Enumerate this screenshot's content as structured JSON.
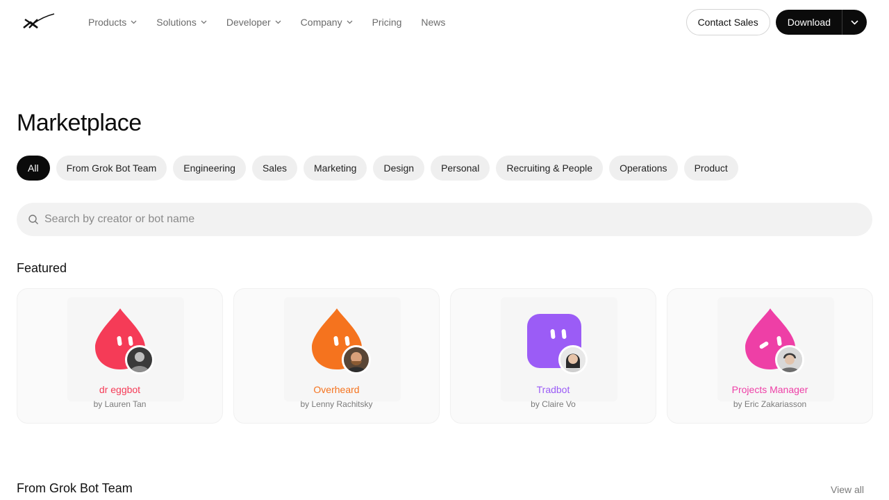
{
  "nav": {
    "items": [
      {
        "label": "Products",
        "has_dropdown": true
      },
      {
        "label": "Solutions",
        "has_dropdown": true
      },
      {
        "label": "Developer",
        "has_dropdown": true
      },
      {
        "label": "Company",
        "has_dropdown": true
      },
      {
        "label": "Pricing",
        "has_dropdown": false
      },
      {
        "label": "News",
        "has_dropdown": false
      }
    ],
    "contact_label": "Contact Sales",
    "download_label": "Download"
  },
  "page": {
    "title": "Marketplace"
  },
  "filters": {
    "chips": [
      "All",
      "From Grok Bot Team",
      "Engineering",
      "Sales",
      "Marketing",
      "Design",
      "Personal",
      "Recruiting & People",
      "Operations",
      "Product"
    ],
    "active": "All"
  },
  "search": {
    "placeholder": "Search by creator or bot name",
    "value": ""
  },
  "featured": {
    "heading": "Featured",
    "cards": [
      {
        "name": "dr eggbot",
        "author": "by Lauren Tan",
        "color": "#f53b57",
        "shape": "drop-bot-icon"
      },
      {
        "name": "Overheard",
        "author": "by Lenny Rachitsky",
        "color": "#f5731e",
        "shape": "drop-bot-icon"
      },
      {
        "name": "Tradbot",
        "author": "by Claire Vo",
        "color": "#9b5cf6",
        "shape": "square-bot-icon"
      },
      {
        "name": "Projects Manager",
        "author": "by Eric Zakariasson",
        "color": "#ee3fa6",
        "shape": "drop-bot-icon"
      }
    ]
  },
  "grok_section": {
    "heading": "From Grok Bot Team",
    "view_all": "View all"
  }
}
